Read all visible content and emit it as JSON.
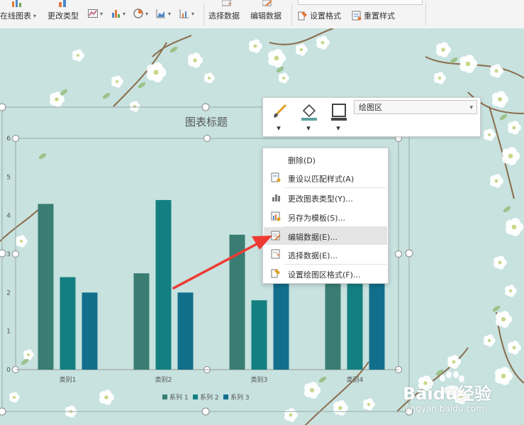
{
  "ribbon": {
    "online_chart": "在线图表",
    "change_type": "更改类型",
    "select_data": "选择数据",
    "edit_data": "编辑数据",
    "set_format": "设置格式",
    "reset_style": "重置样式"
  },
  "format_toolbar": {
    "style": "样式",
    "fill": "填充",
    "outline": "轮廓",
    "area_selector": "绘图区"
  },
  "context_menu": {
    "items": [
      {
        "label": "删除(D)",
        "icon": "delete-icon"
      },
      {
        "label": "重设以匹配样式(A)",
        "icon": "reset-style-icon"
      },
      {
        "label": "更改图表类型(Y)...",
        "icon": "chart-type-icon"
      },
      {
        "label": "另存为模板(S)...",
        "icon": "save-template-icon"
      },
      {
        "label": "编辑数据(E)...",
        "icon": "edit-data-icon",
        "highlighted": true
      },
      {
        "label": "选择数据(E)...",
        "icon": "select-data-icon"
      },
      {
        "label": "设置绘图区格式(F)...",
        "icon": "format-plot-icon"
      }
    ]
  },
  "chart_data": {
    "type": "bar",
    "title": "图表标题",
    "categories": [
      "类别1",
      "类别2",
      "类别3",
      "类别4"
    ],
    "series": [
      {
        "name": "系列 1",
        "values": [
          4.3,
          2.5,
          3.5,
          4.5
        ]
      },
      {
        "name": "系列 2",
        "values": [
          2.4,
          4.4,
          1.8,
          2.8
        ]
      },
      {
        "name": "系列 3",
        "values": [
          2,
          2,
          3,
          5
        ]
      }
    ],
    "ylim": [
      0,
      6
    ],
    "yticks": [
      "0",
      "1",
      "2",
      "3",
      "4",
      "5",
      "6"
    ],
    "legend_position": "bottom",
    "colors": [
      "#3a7d73",
      "#147f80",
      "#126f8c"
    ]
  },
  "watermark": {
    "brand": "Baidu经验",
    "url": "jingyan.baidu.com"
  }
}
